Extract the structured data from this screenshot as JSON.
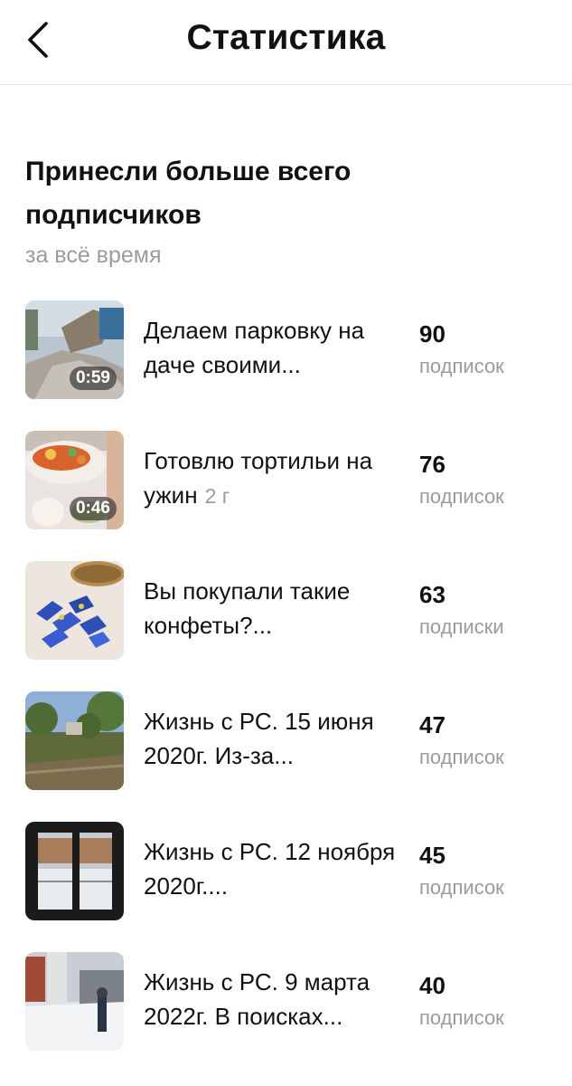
{
  "header": {
    "title": "Статистика",
    "back_icon": "chevron-left-icon"
  },
  "section": {
    "title": "Принесли больше всего подписчиков",
    "subtitle": "за всё время"
  },
  "items": [
    {
      "title": "Делаем парковку на даче своими...",
      "age": "",
      "duration": "0:59",
      "count": "90",
      "label": "подписок"
    },
    {
      "title": "Готовлю тортильи на ужин",
      "age": "2 г",
      "duration": "0:46",
      "count": "76",
      "label": "подписок"
    },
    {
      "title": "Вы покупали такие конфеты?...",
      "age": "",
      "duration": "",
      "count": "63",
      "label": "подписки"
    },
    {
      "title": "Жизнь с РС. 15 июня 2020г. Из-за...",
      "age": "",
      "duration": "",
      "count": "47",
      "label": "подписок"
    },
    {
      "title": "Жизнь с РС. 12 ноября 2020г....",
      "age": "",
      "duration": "",
      "count": "45",
      "label": "подписок"
    },
    {
      "title": "Жизнь с РС. 9 марта 2022г. В поисках...",
      "age": "",
      "duration": "",
      "count": "40",
      "label": "подписок"
    }
  ]
}
